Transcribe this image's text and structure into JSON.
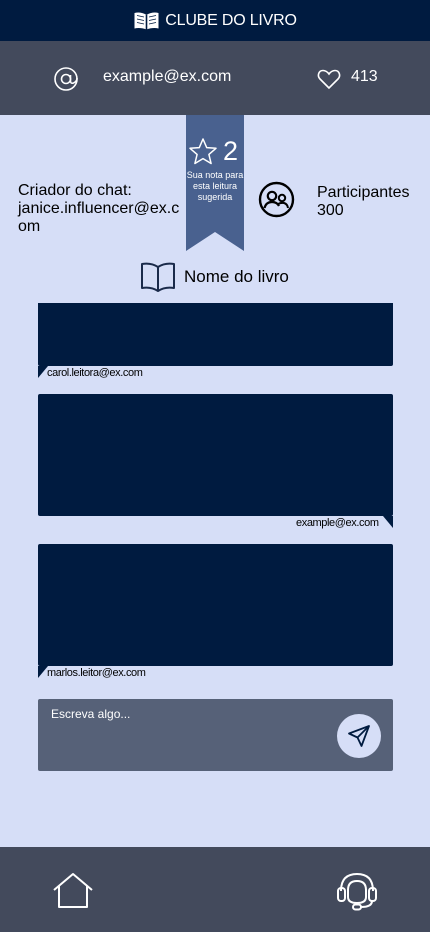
{
  "app": {
    "title": "CLUBE DO LIVRO",
    "logo_icon": "open-book-icon"
  },
  "user": {
    "email": "example@ex.com",
    "likes": "413",
    "at_icon": "at-icon",
    "heart_icon": "heart-icon"
  },
  "chat": {
    "creator_label": "Criador do chat:",
    "creator_email": "janice.influencer@ex.com",
    "participants_label": "Participantes",
    "participants_count": "300",
    "book_title": "Nome do livro"
  },
  "rating": {
    "value": "2",
    "caption": "Sua nota para esta leitura sugerida",
    "icon": "star-icon"
  },
  "messages": [
    {
      "author": "carol.leitora@ex.com",
      "text": "",
      "align": "left"
    },
    {
      "author": "example@ex.com",
      "text": "",
      "align": "right"
    },
    {
      "author": "marlos.leitor@ex.com",
      "text": "",
      "align": "left"
    }
  ],
  "composer": {
    "placeholder": "Escreva algo...",
    "send_icon": "send-icon"
  },
  "bottom_nav": {
    "home_icon": "home-icon",
    "support_icon": "headset-icon"
  },
  "colors": {
    "navy": "#001b40",
    "bar": "#434a5c",
    "background": "#d6def7",
    "ribbon": "#49618f",
    "composer": "#566178"
  }
}
